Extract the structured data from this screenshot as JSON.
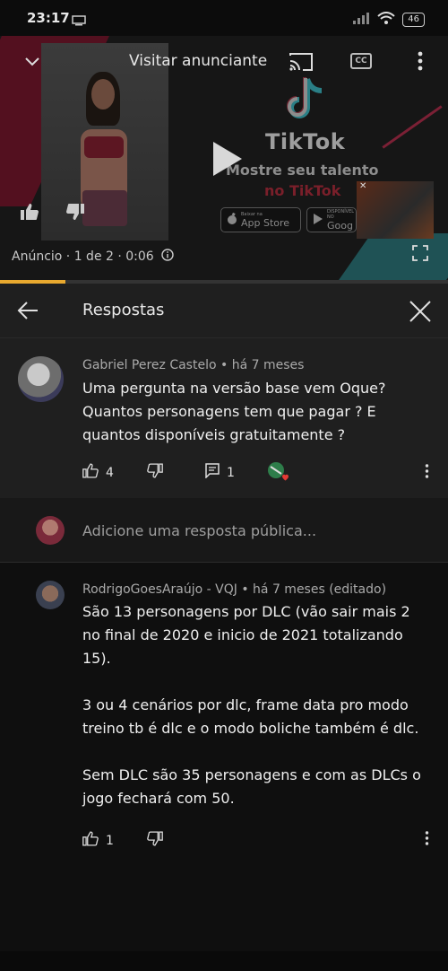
{
  "status_bar": {
    "time": "23:17",
    "battery": "46"
  },
  "video": {
    "visit_advertiser": "Visitar anunciante",
    "cc": "CC",
    "brand": "TikTok",
    "promo_line1": "Mostre seu talento",
    "promo_line2": "no TikTok",
    "store_apple_small": "Baixar na",
    "store_apple": "App Store",
    "store_google_small": "DISPONÍVEL NO",
    "store_google": "Goog",
    "ad_info": "Anúncio · 1 de 2 · 0:06",
    "progress_percent": 14.6
  },
  "replies_header": {
    "title": "Respostas"
  },
  "parent_comment": {
    "author_meta": "Gabriel Perez Castelo • há 7 meses",
    "text": "Uma pergunta na versão base vem Oque? Quantos personagens tem que pagar ? E quantos disponíveis gratuitamente ?",
    "likes": "4",
    "replies": "1"
  },
  "add_reply": {
    "placeholder": "Adicione uma resposta pública..."
  },
  "reply": {
    "author_meta": "RodrigoGoesAraújo - VQJ • há 7 meses (editado)",
    "text": "São 13 personagens por DLC (vão sair mais 2 no final de 2020 e inicio de 2021 totalizando 15).\n\n3 ou 4 cenários por dlc, frame data pro modo treino tb é dlc e o modo boliche também é dlc.\n\nSem DLC são 35 personagens e com as DLCs o jogo fechará com 50.",
    "likes": "1"
  },
  "colors": {
    "accent_progress": "#e9a92f",
    "background": "#0f0f0f",
    "panel": "#1f1f1f"
  }
}
